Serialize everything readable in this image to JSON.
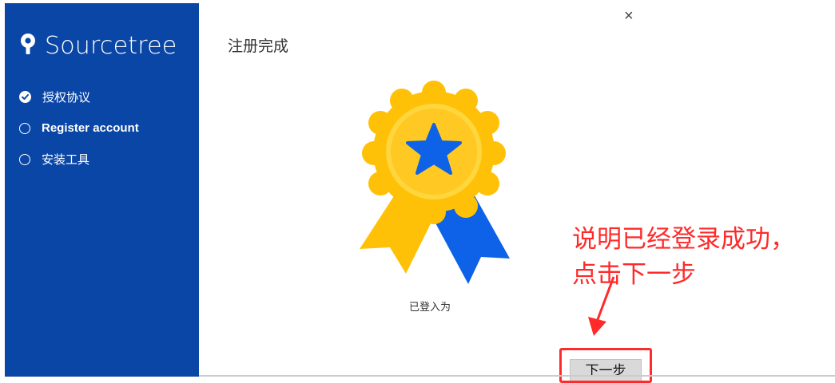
{
  "app": {
    "name": "Sourcetree"
  },
  "sidebar": {
    "steps": [
      {
        "label": "授权协议",
        "status": "completed"
      },
      {
        "label": "Register account",
        "status": "current"
      },
      {
        "label": "安装工具",
        "status": "pending"
      }
    ]
  },
  "main": {
    "title": "注册完成",
    "close_label": "×",
    "logged_in_text": "已登入为",
    "next_label": "下一步"
  },
  "annotation": {
    "line1": "说明已经登录成功，",
    "line2": "点击下一步"
  },
  "colors": {
    "sidebar": "#0a46a6",
    "annotation": "#ff2a2a",
    "badge_gold": "#ffc107",
    "badge_blue": "#0d62e8"
  }
}
